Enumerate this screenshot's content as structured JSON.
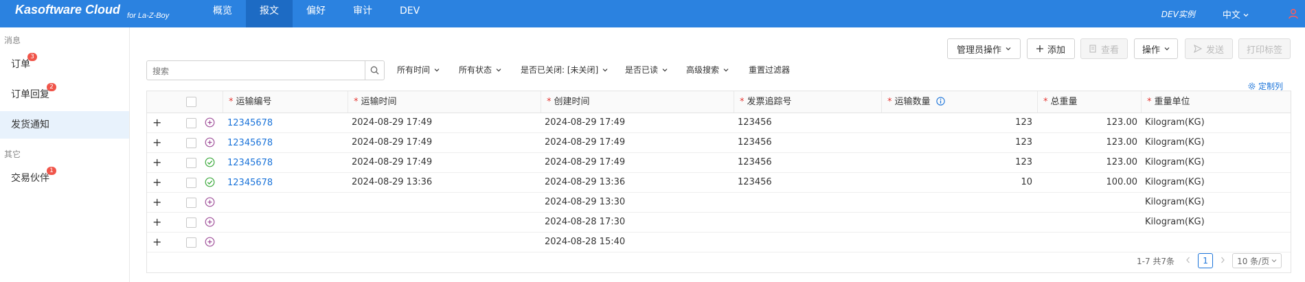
{
  "app": {
    "brand": "Kasoftware Cloud",
    "brand_sub": "for La-Z-Boy",
    "env": "DEV实例",
    "language": "中文",
    "accent": "#2b82e0"
  },
  "nav": [
    {
      "label": "概览"
    },
    {
      "label": "报文",
      "active": true
    },
    {
      "label": "偏好"
    },
    {
      "label": "审计"
    },
    {
      "label": "DEV"
    }
  ],
  "sidebar": {
    "group1": "消息",
    "items": [
      {
        "label": "订单",
        "badge": "3"
      },
      {
        "label": "订单回复",
        "badge": "2"
      },
      {
        "label": "发货通知",
        "active": true
      }
    ],
    "group2": "其它",
    "items2": [
      {
        "label": "交易伙伴",
        "badge": "1"
      }
    ]
  },
  "toolbar": {
    "admin_ops": "管理员操作",
    "add": "添加",
    "view": "查看",
    "ops": "操作",
    "send": "发送",
    "print_label": "打印标签"
  },
  "search": {
    "placeholder": "搜索"
  },
  "filters": {
    "time": "所有时间",
    "status": "所有状态",
    "closed": "是否已关闭: [未关闭]",
    "read": "是否已读",
    "advanced": "高级搜索",
    "reset": "重置过滤器"
  },
  "customize": "定制列",
  "table": {
    "columns": {
      "shipment_no": "运输编号",
      "ship_time": "运输时间",
      "created": "创建时间",
      "invoice_track": "发票追踪号",
      "quantity": "运输数量",
      "total_weight": "总重量",
      "weight_unit": "重量单位"
    },
    "rows": [
      {
        "status": "pending",
        "shipment_no": "12345678",
        "ship_time": "2024-08-29 17:49",
        "created": "2024-08-29 17:49",
        "invoice_track": "123456",
        "quantity": "123",
        "total_weight": "123.00",
        "weight_unit": "Kilogram(KG)"
      },
      {
        "status": "pending",
        "shipment_no": "12345678",
        "ship_time": "2024-08-29 17:49",
        "created": "2024-08-29 17:49",
        "invoice_track": "123456",
        "quantity": "123",
        "total_weight": "123.00",
        "weight_unit": "Kilogram(KG)"
      },
      {
        "status": "done",
        "shipment_no": "12345678",
        "ship_time": "2024-08-29 17:49",
        "created": "2024-08-29 17:49",
        "invoice_track": "123456",
        "quantity": "123",
        "total_weight": "123.00",
        "weight_unit": "Kilogram(KG)"
      },
      {
        "status": "done",
        "shipment_no": "12345678",
        "ship_time": "2024-08-29 13:36",
        "created": "2024-08-29 13:36",
        "invoice_track": "123456",
        "quantity": "10",
        "total_weight": "100.00",
        "weight_unit": "Kilogram(KG)"
      },
      {
        "status": "pending",
        "shipment_no": "",
        "ship_time": "",
        "created": "2024-08-29 13:30",
        "invoice_track": "",
        "quantity": "",
        "total_weight": "",
        "weight_unit": "Kilogram(KG)"
      },
      {
        "status": "pending",
        "shipment_no": "",
        "ship_time": "",
        "created": "2024-08-28 17:30",
        "invoice_track": "",
        "quantity": "",
        "total_weight": "",
        "weight_unit": "Kilogram(KG)"
      },
      {
        "status": "pending",
        "shipment_no": "",
        "ship_time": "",
        "created": "2024-08-28 15:40",
        "invoice_track": "",
        "quantity": "",
        "total_weight": "",
        "weight_unit": ""
      }
    ]
  },
  "pagination": {
    "summary": "1-7 共7条",
    "current": "1",
    "page_size": "10 条/页"
  },
  "colors": {
    "link": "#1a73d9",
    "pending": "#a0509a",
    "done": "#3caa3c",
    "badge": "#f0554a"
  }
}
